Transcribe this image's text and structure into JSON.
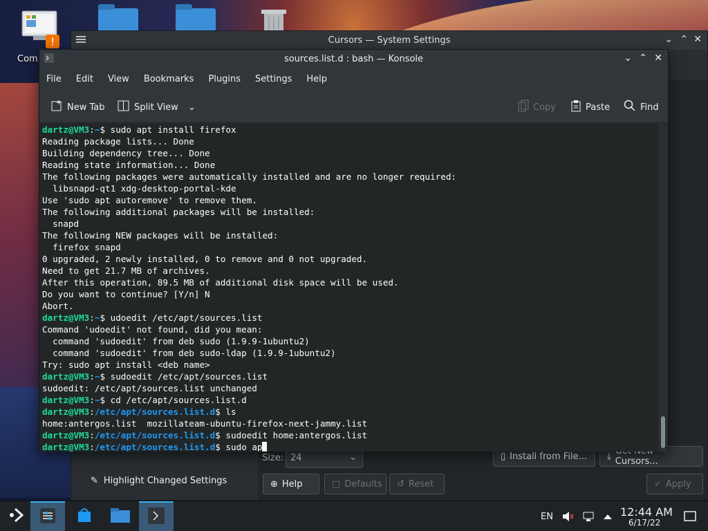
{
  "desktop": {
    "computer_label": "Comp",
    "icons": [
      "computer-icon",
      "folder-icon",
      "folder-icon",
      "trash-icon"
    ]
  },
  "system_settings": {
    "title": "Cursors — System Settings",
    "highlight_label": "Highlight Changed Settings",
    "size_label": "Size:",
    "size_value": "24",
    "install_label": "Install from File...",
    "get_new_label": "Get New Cursors...",
    "help_label": "Help",
    "defaults_label": "Defaults",
    "reset_label": "Reset",
    "apply_label": "Apply"
  },
  "konsole": {
    "title": "sources.list.d : bash — Konsole",
    "menu": [
      "File",
      "Edit",
      "View",
      "Bookmarks",
      "Plugins",
      "Settings",
      "Help"
    ],
    "toolbar": {
      "new_tab": "New Tab",
      "split_view": "Split View",
      "copy": "Copy",
      "paste": "Paste",
      "find": "Find"
    },
    "terminal": {
      "lines": [
        {
          "user": "dartz@VM3",
          "path": "~",
          "cmd": "sudo apt install firefox"
        },
        {
          "text": "Reading package lists... Done"
        },
        {
          "text": "Building dependency tree... Done"
        },
        {
          "text": "Reading state information... Done"
        },
        {
          "text": "The following packages were automatically installed and are no longer required:"
        },
        {
          "text": "  libsnapd-qt1 xdg-desktop-portal-kde"
        },
        {
          "text": "Use 'sudo apt autoremove' to remove them."
        },
        {
          "text": "The following additional packages will be installed:"
        },
        {
          "text": "  snapd"
        },
        {
          "text": "The following NEW packages will be installed:"
        },
        {
          "text": "  firefox snapd"
        },
        {
          "text": "0 upgraded, 2 newly installed, 0 to remove and 0 not upgraded."
        },
        {
          "text": "Need to get 21.7 MB of archives."
        },
        {
          "text": "After this operation, 89.5 MB of additional disk space will be used."
        },
        {
          "text": "Do you want to continue? [Y/n] N"
        },
        {
          "text": "Abort."
        },
        {
          "user": "dartz@VM3",
          "path": "~",
          "cmd": "udoedit /etc/apt/sources.list"
        },
        {
          "text": "Command 'udoedit' not found, did you mean:"
        },
        {
          "text": "  command 'sudoedit' from deb sudo (1.9.9-1ubuntu2)"
        },
        {
          "text": "  command 'sudoedit' from deb sudo-ldap (1.9.9-1ubuntu2)"
        },
        {
          "text": "Try: sudo apt install <deb name>"
        },
        {
          "user": "dartz@VM3",
          "path": "~",
          "cmd": "sudoedit /etc/apt/sources.list"
        },
        {
          "text": "sudoedit: /etc/apt/sources.list unchanged"
        },
        {
          "user": "dartz@VM3",
          "path": "~",
          "cmd": "cd /etc/apt/sources.list.d"
        },
        {
          "user": "dartz@VM3",
          "path": "/etc/apt/sources.list.d",
          "cmd": "ls"
        },
        {
          "text": "home:antergos.list  mozillateam-ubuntu-firefox-next-jammy.list"
        },
        {
          "user": "dartz@VM3",
          "path": "/etc/apt/sources.list.d",
          "cmd": "sudoedit home:antergos.list"
        },
        {
          "user": "dartz@VM3",
          "path": "/etc/apt/sources.list.d",
          "cmd": "sudo ap",
          "cursor": true
        }
      ]
    }
  },
  "taskbar": {
    "language": "EN",
    "time": "12:44 AM",
    "date": "6/17/22"
  },
  "colors": {
    "prompt_user": "#1cdc9a",
    "prompt_path": "#1d99f3",
    "terminal_bg": "#232627",
    "accent": "#3daee9"
  }
}
